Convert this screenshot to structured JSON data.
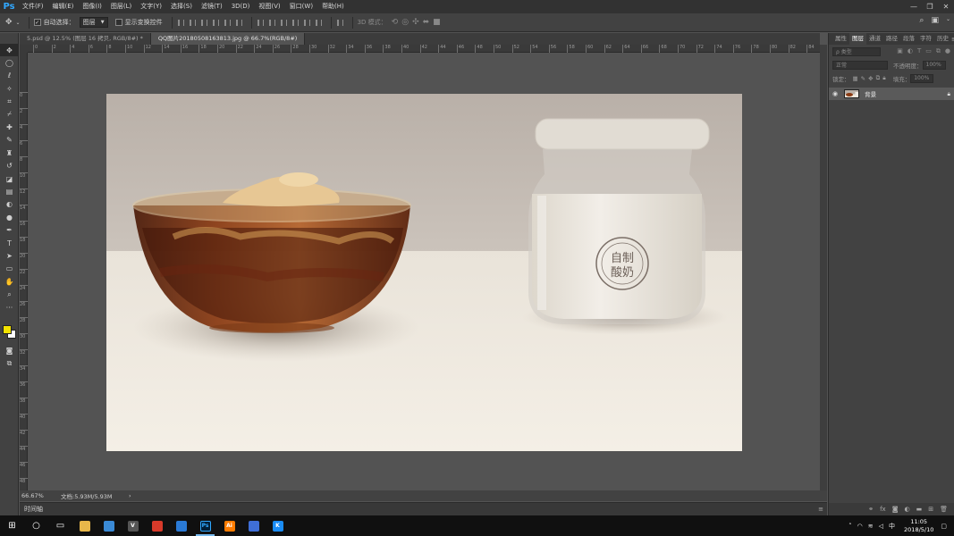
{
  "app": {
    "logo": "Ps"
  },
  "menu": [
    "文件(F)",
    "编辑(E)",
    "图像(I)",
    "图层(L)",
    "文字(Y)",
    "选择(S)",
    "滤镜(T)",
    "3D(D)",
    "视图(V)",
    "窗口(W)",
    "帮助(H)"
  ],
  "window_controls": {
    "minimize": "—",
    "restore": "❐",
    "close": "✕"
  },
  "options": {
    "auto_select_label": "自动选择：",
    "auto_select_checked": true,
    "auto_select_target": "图层",
    "show_transform_label": "显示变换控件",
    "show_transform_checked": false,
    "mode_3d_label": "3D 模式："
  },
  "tabs": [
    {
      "label": "5.psd @ 12.5% (图层 16 拷贝, RGB/8#) *",
      "active": false
    },
    {
      "label": "QQ图片20180508163813.jpg @ 66.7%(RGB/8#)",
      "active": true
    }
  ],
  "ruler_h_labels": [
    "0",
    "2",
    "4",
    "6",
    "8",
    "10",
    "12",
    "14",
    "16",
    "18",
    "20",
    "22",
    "24",
    "26",
    "28",
    "30",
    "32",
    "34",
    "36",
    "38",
    "40",
    "42",
    "44",
    "46",
    "48",
    "50",
    "52",
    "54",
    "56",
    "58",
    "60",
    "62",
    "64",
    "66",
    "68",
    "70",
    "72",
    "74",
    "76",
    "78",
    "80",
    "82",
    "84"
  ],
  "ruler_v_labels": [
    "0",
    "2",
    "4",
    "6",
    "8",
    "10",
    "12",
    "14",
    "16",
    "18",
    "20",
    "22",
    "24",
    "26",
    "28",
    "30",
    "32",
    "34",
    "36",
    "38",
    "40",
    "42",
    "44",
    "46",
    "48",
    "50"
  ],
  "colors": {
    "foreground": "#f2e200",
    "background": "#ffffff",
    "accent": "#31a8ff"
  },
  "status": {
    "zoom": "66.67%",
    "doc_info": "文档:5.93M/5.93M",
    "arrow": "›"
  },
  "timeline_label": "时间轴",
  "panel": {
    "tabs": [
      {
        "label": "属性",
        "active": false
      },
      {
        "label": "图层",
        "active": true
      },
      {
        "label": "通道",
        "active": false
      },
      {
        "label": "路径",
        "active": false
      },
      {
        "label": "段落",
        "active": false
      },
      {
        "label": "字符",
        "active": false
      },
      {
        "label": "历史",
        "active": false
      }
    ],
    "filter_placeholder": "ρ 类型",
    "blend_mode": "正常",
    "opacity_label": "不透明度：",
    "opacity_value": "100%",
    "lock_label": "锁定：",
    "fill_label": "填充：",
    "fill_value": "100%",
    "layers": [
      {
        "name": "背景",
        "visible": true,
        "locked": true
      }
    ]
  },
  "jar_label": [
    "自制",
    "酸奶"
  ],
  "taskbar": {
    "apps": [
      {
        "name": "windows-start-icon",
        "glyph": "⊞",
        "color": "#ffffff",
        "active": false
      },
      {
        "name": "search-icon",
        "glyph": "○",
        "color": "#ffffff",
        "active": false
      },
      {
        "name": "task-view-icon",
        "glyph": "▭",
        "color": "#ffffff",
        "active": false
      },
      {
        "name": "file-explorer-icon",
        "glyph": "",
        "color": "#e8b74a",
        "active": false
      },
      {
        "name": "store-icon",
        "glyph": "",
        "color": "#3a8ad6",
        "active": false
      },
      {
        "name": "vectorizer-icon",
        "glyph": "V",
        "color": "#555555",
        "active": false
      },
      {
        "name": "qq-icon",
        "glyph": "",
        "color": "#d83a2a",
        "active": false
      },
      {
        "name": "mail-icon",
        "glyph": "",
        "color": "#2a7ad6",
        "active": false
      },
      {
        "name": "photoshop-icon",
        "glyph": "Ps",
        "color": "#001e36",
        "active": true
      },
      {
        "name": "illustrator-icon",
        "glyph": "Ai",
        "color": "#ff7c00",
        "active": false
      },
      {
        "name": "browser-icon",
        "glyph": "",
        "color": "#3f6fd8",
        "active": false
      },
      {
        "name": "kugou-icon",
        "glyph": "K",
        "color": "#1a8cf5",
        "active": false
      }
    ],
    "tray_ime": "中",
    "time": "11:05",
    "date": "2018/5/10"
  }
}
